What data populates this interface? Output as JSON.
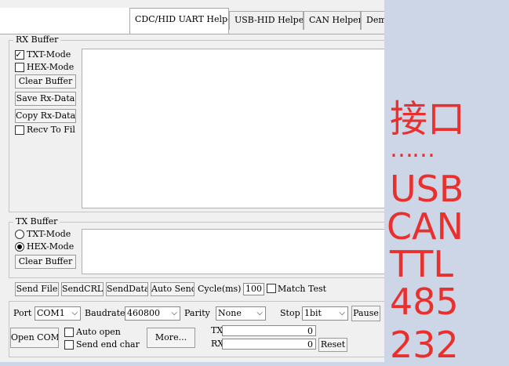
{
  "tabs": [
    {
      "label": "CDC/HID UART Helper",
      "active": true
    },
    {
      "label": "USB-HID Helper",
      "active": false
    },
    {
      "label": "CAN Helper",
      "active": false
    },
    {
      "label": "Demo",
      "active": false
    }
  ],
  "rx": {
    "title": "RX Buffer",
    "txt_mode": "TXT-Mode",
    "hex_mode": "HEX-Mode",
    "clear": "Clear Buffer",
    "save": "Save Rx-Data",
    "copy": "Copy Rx-Data",
    "recv_file": "Recv To Fil"
  },
  "tx": {
    "title": "TX Buffer",
    "txt_mode": "TXT-Mode",
    "hex_mode": "HEX-Mode",
    "clear": "Clear Buffer"
  },
  "actions": {
    "send_file": "Send File",
    "send_crlf": "SendCRLF",
    "send_data": "SendData",
    "auto_send": "Auto Send",
    "cycle_label": "Cycle(ms)",
    "cycle_value": "100",
    "match_test": "Match Test"
  },
  "config": {
    "port_label": "Port",
    "port_value": "COM1",
    "baud_label": "Baudrate",
    "baud_value": "460800",
    "parity_label": "Parity",
    "parity_value": "None",
    "stop_label": "Stop",
    "stop_value": "1bit",
    "pause": "Pause",
    "open_com": "Open COM",
    "auto_open": "Auto open",
    "send_end_char": "Send end char",
    "more": "More...",
    "tx_label": "TX",
    "tx_count": "0",
    "rx_label": "RX",
    "rx_count": "0",
    "reset": "Reset"
  },
  "overlay": {
    "line1": "接口",
    "line2": "……",
    "line3": "USB",
    "line4": "CAN",
    "line5": "TTL",
    "line6": "485",
    "line7": "232",
    "color": "#e8312e"
  }
}
